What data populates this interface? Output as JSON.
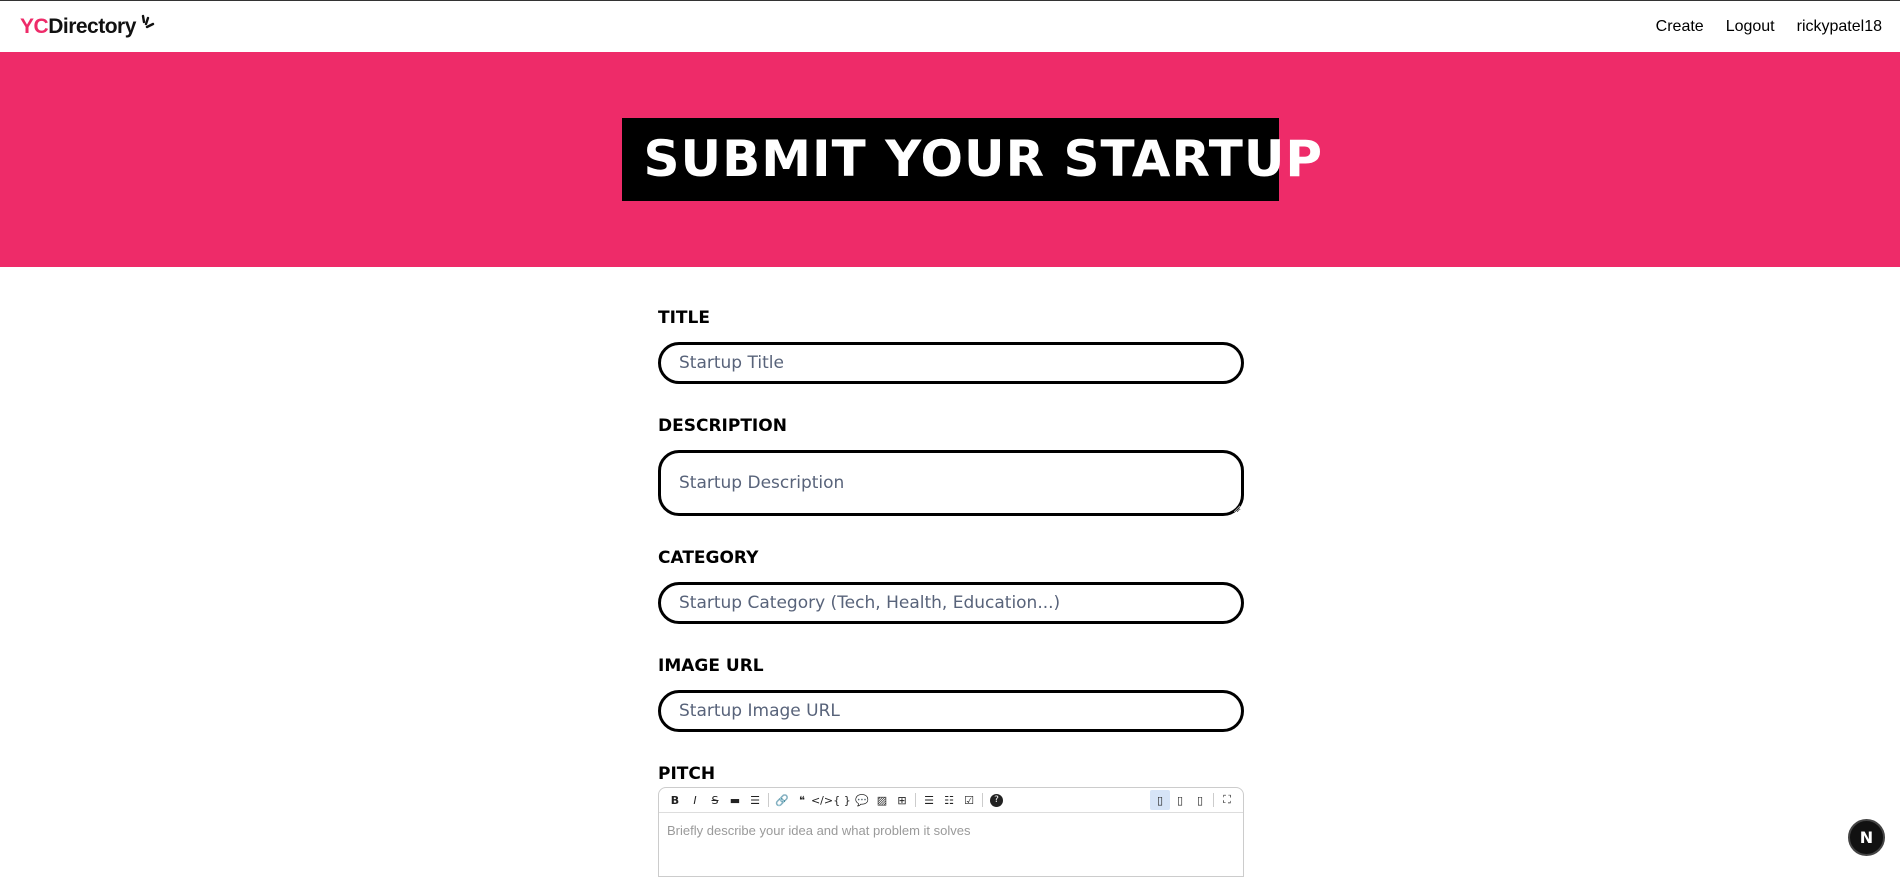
{
  "navbar": {
    "logo_yc": "YC",
    "logo_directory": "Directory",
    "links": {
      "create": "Create",
      "logout": "Logout",
      "username": "rickypatel18"
    }
  },
  "hero": {
    "title": "SUBMIT YOUR STARTUP"
  },
  "form": {
    "title": {
      "label": "TITLE",
      "placeholder": "Startup Title"
    },
    "description": {
      "label": "DESCRIPTION",
      "placeholder": "Startup Description"
    },
    "category": {
      "label": "CATEGORY",
      "placeholder": "Startup Category (Tech, Health, Education...)"
    },
    "image_url": {
      "label": "IMAGE URL",
      "placeholder": "Startup Image URL"
    },
    "pitch": {
      "label": "PITCH",
      "placeholder": "Briefly describe your idea and what problem it solves"
    }
  },
  "toolbar": {
    "bold": "B",
    "italic": "I",
    "strike": "S",
    "hr": "▬",
    "title": "☰",
    "link": "🔗",
    "quote": "❝",
    "code": "</>",
    "codeblock": "{ }",
    "comment": "💬",
    "image": "▨",
    "table": "⊞",
    "ul": "☰",
    "ol": "☷",
    "checked": "☑",
    "help": "?",
    "edit": "▯",
    "live": "▯",
    "preview": "▯",
    "fullscreen": "⛶"
  },
  "badge": {
    "letter": "N"
  },
  "colors": {
    "brand_pink": "#ee2b69",
    "brand_black": "#000000",
    "placeholder": "#58637a"
  }
}
